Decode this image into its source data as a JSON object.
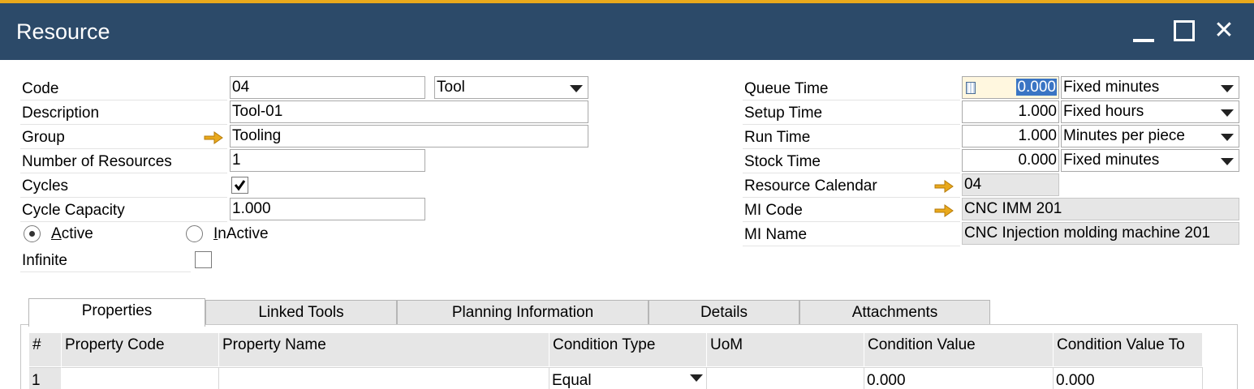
{
  "window": {
    "title": "Resource",
    "controls": {
      "minimize": "minimize-icon",
      "maximize": "maximize-icon",
      "close": "close-icon"
    },
    "title_bar_color": "#2c4a69",
    "accent_color": "#e9a91c"
  },
  "left": {
    "code": {
      "label": "Code",
      "value": "04",
      "type_value": "Tool"
    },
    "description": {
      "label": "Description",
      "value": "Tool-01"
    },
    "group": {
      "label": "Group",
      "value": "Tooling"
    },
    "number_of_resources": {
      "label": "Number of Resources",
      "value": "1"
    },
    "cycles": {
      "label": "Cycles",
      "checked": true
    },
    "cycle_capacity": {
      "label": "Cycle Capacity",
      "value": "1.000"
    },
    "status": {
      "active_label": "Active",
      "inactive_label": "InActive",
      "selected": "Active"
    },
    "infinite": {
      "label": "Infinite",
      "checked": false
    }
  },
  "right": {
    "queue_time": {
      "label": "Queue Time",
      "value": "0.000",
      "unit": "Fixed minutes"
    },
    "setup_time": {
      "label": "Setup Time",
      "value": "1.000",
      "unit": "Fixed hours"
    },
    "run_time": {
      "label": "Run Time",
      "value": "1.000",
      "unit": "Minutes per piece"
    },
    "stock_time": {
      "label": "Stock Time",
      "value": "0.000",
      "unit": "Fixed minutes"
    },
    "resource_calendar": {
      "label": "Resource Calendar",
      "value": "04"
    },
    "mi_code": {
      "label": "MI Code",
      "value": "CNC IMM 201"
    },
    "mi_name": {
      "label": "MI Name",
      "value": "CNC Injection molding machine 201"
    }
  },
  "tabs": [
    {
      "label": "Properties",
      "active": true
    },
    {
      "label": "Linked Tools",
      "active": false
    },
    {
      "label": "Planning Information",
      "active": false
    },
    {
      "label": "Details",
      "active": false
    },
    {
      "label": "Attachments",
      "active": false
    }
  ],
  "properties_grid": {
    "columns": [
      "#",
      "Property Code",
      "Property Name",
      "Condition Type",
      "UoM",
      "Condition Value",
      "Condition Value To"
    ],
    "rows": [
      {
        "num": "1",
        "property_code": "",
        "property_name": "",
        "condition_type": "Equal",
        "uom": "",
        "condition_value": "0.000",
        "condition_value_to": "0.000"
      }
    ]
  }
}
